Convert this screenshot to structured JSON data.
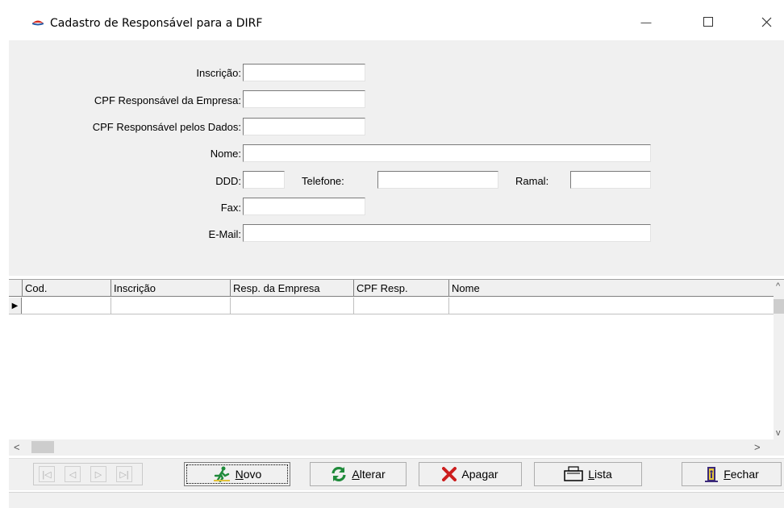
{
  "window": {
    "title": "Cadastro de Responsável para a DIRF",
    "min_glyph": "—",
    "max_glyph": "☐",
    "close_glyph": "✕"
  },
  "form": {
    "inscricao_label": "Inscrição:",
    "cpf_empresa_label": "CPF Responsável da Empresa:",
    "cpf_dados_label": "CPF Responsável pelos Dados:",
    "nome_label": "Nome:",
    "ddd_label": "DDD:",
    "telefone_label": "Telefone:",
    "ramal_label": "Ramal:",
    "fax_label": "Fax:",
    "email_label": "E-Mail:"
  },
  "grid": {
    "columns": [
      "Cod.",
      "Inscrição",
      "Resp. da Empresa",
      "CPF Resp.",
      "Nome"
    ],
    "row_indicator": "▶",
    "scroll_left": "<",
    "scroll_right": ">",
    "scroll_up": "^",
    "scroll_down": "v"
  },
  "toolbar": {
    "nav_first": "|◁",
    "nav_prev": "◁",
    "nav_next": "▷",
    "nav_last": "▷|",
    "novo": {
      "accel": "N",
      "rest": "ovo"
    },
    "alterar": {
      "accel": "A",
      "rest": "lterar"
    },
    "apagar": {
      "label": "Apagar"
    },
    "lista": {
      "accel": "L",
      "rest": "ista"
    },
    "fechar": {
      "accel": "F",
      "rest": "echar"
    }
  },
  "colors": {
    "accent_red": "#d62b1f",
    "green": "#1f8a3a",
    "apagar_x": "#cc1e1e"
  }
}
